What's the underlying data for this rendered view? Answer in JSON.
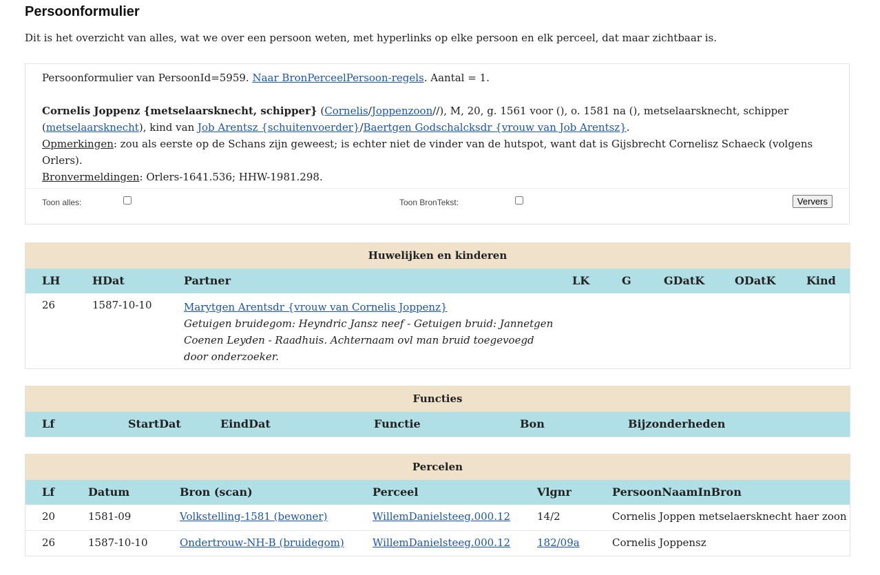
{
  "page": {
    "title": "Persoonformulier",
    "intro": "Dit is het overzicht van alles, wat we over een persoon weten, met hyperlinks op elke persoon en elk perceel, dat maar zichtbaar is."
  },
  "summary": {
    "line1_prefix": "Persoonformulier van PersoonId=5959. ",
    "line1_link": "Naar BronPerceelPersoon-regels",
    "line1_suffix": ". Aantal = 1.",
    "person_name": "Cornelis Joppenz {metselaarsknecht, schipper}",
    "paren_open": " (",
    "firstname_link": "Cornelis",
    "slash": "/",
    "patronym_link": "Joppenzoon",
    "mid_text": "//), M, 20, g. 1561 voor (), o. 1581 na (), metselaarsknecht, schipper (",
    "occupation_link": "metselaarsknecht",
    "child_of": "), kind van ",
    "father_link": "Job Arentsz {schuitenvoerder}",
    "mother_link": "Baertgen Godschalcksdr {vrouw van Job Arentsz}",
    "period": ".",
    "remarks_label": "Opmerkingen",
    "remarks_text": ": zou als eerste op de Schans zijn geweest; is echter niet de vinder van de hutspot, want dat is Gijsbrecht Cornelisz Schaeck (volgens",
    "remarks_text2": "Orlers).",
    "sources_label": "Bronvermeldingen",
    "sources_text": ": Orlers-1641.536; HHW-1981.298."
  },
  "controls": {
    "show_all_label": "Toon alles:",
    "show_all_checked": false,
    "show_source_label": "Toon BronTekst:",
    "show_source_checked": false,
    "refresh_label": "Ververs"
  },
  "marriages": {
    "title": "Huwelijken en kinderen",
    "columns": [
      "LH",
      "HDat",
      "Partner",
      "LK",
      "G",
      "GDatK",
      "ODatK",
      "Kind"
    ],
    "rows": [
      {
        "lh": "26",
        "hdat": "1587-10-10",
        "partner": "Marytgen Arentsdr {vrouw van Cornelis Joppenz}",
        "note_line1": "Getuigen bruidegom: Heyndric Jansz neef - Getuigen bruid: Jannetgen",
        "note_line2": "Coenen Leyden - Raadhuis. Achternaam ovl man bruid toegevoegd",
        "note_line3": "door onderzoeker."
      }
    ]
  },
  "functions": {
    "title": "Functies",
    "columns": [
      "Lf",
      "StartDat",
      "EindDat",
      "Functie",
      "Bon",
      "Bijzonderheden"
    ]
  },
  "parcels": {
    "title": "Percelen",
    "columns": [
      "Lf",
      "Datum",
      "Bron (scan)",
      "Perceel",
      "Vlgnr",
      "PersoonNaamInBron"
    ],
    "rows": [
      {
        "lf": "20",
        "datum": "1581-09",
        "bron": "Volkstelling-1581 (bewoner)",
        "perceel": "WillemDanielsteeg.000.12",
        "vlgnr": "14/2",
        "naam": "Cornelis Joppen metselaersknecht haer zoon"
      },
      {
        "lf": "26",
        "datum": "1587-10-10",
        "bron": "Ondertrouw-NH-B (bruidegom)",
        "perceel": "WillemDanielsteeg.000.12",
        "vlgnr": "182/09a",
        "naam": "Cornelis Joppensz"
      }
    ]
  }
}
